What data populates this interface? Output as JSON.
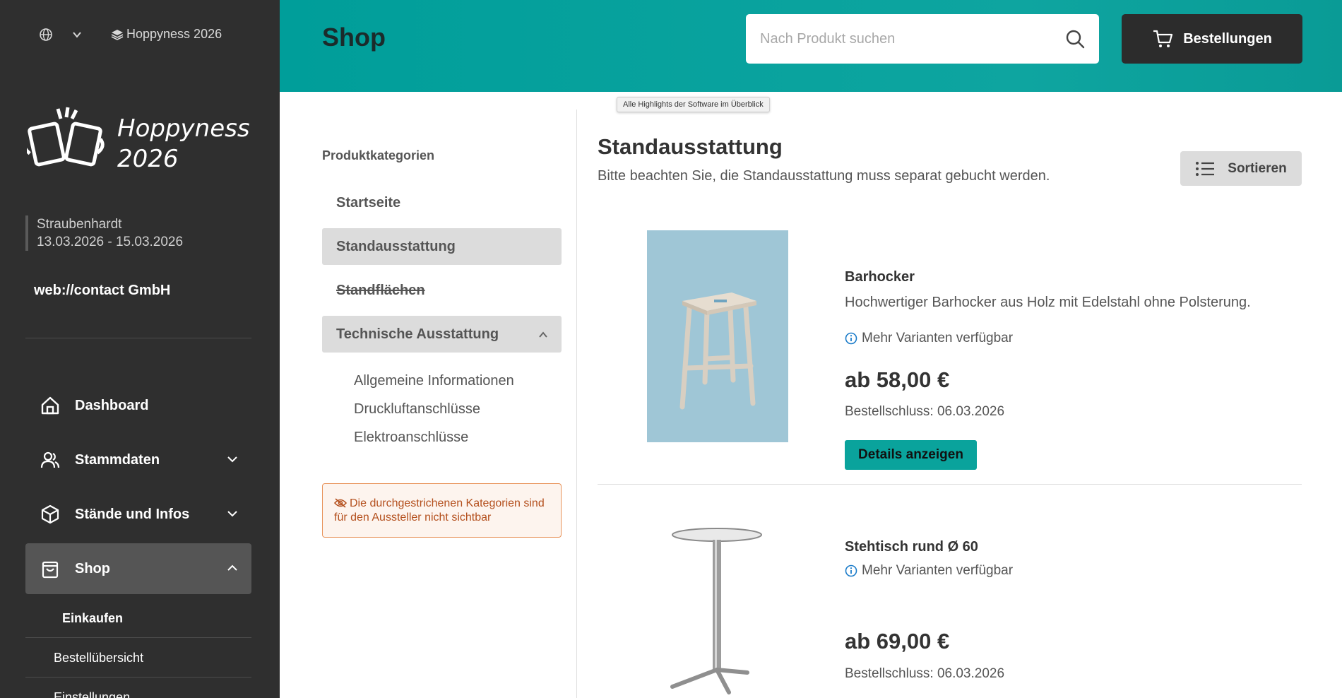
{
  "sidebar": {
    "event_name": "Hoppyness 2026",
    "logo_text_line1": "Hoppyness",
    "logo_text_line2": "2026",
    "location": "Straubenhardt",
    "dates": "13.03.2026 - 15.03.2026",
    "company": "web://contact GmbH",
    "nav": [
      {
        "label": "Dashboard",
        "icon": "home-icon"
      },
      {
        "label": "Stammdaten",
        "icon": "users-icon"
      },
      {
        "label": "Stände und Infos",
        "icon": "box-icon"
      },
      {
        "label": "Shop",
        "icon": "shopping-bag-icon"
      }
    ],
    "shop_sub": [
      "Einkaufen",
      "Bestellübersicht",
      "Einstellungen"
    ]
  },
  "header": {
    "title": "Shop",
    "search_placeholder": "Nach Produkt suchen",
    "orders_label": "Bestellungen"
  },
  "tooltip": "Alle Highlights der Software im Überblick",
  "categories": {
    "title": "Produktkategorien",
    "items": [
      "Startseite",
      "Standausstattung",
      "Standflächen",
      "Technische Ausstattung"
    ],
    "sub_items": [
      "Allgemeine Informationen",
      "Druckluftanschlüsse",
      "Elektroanschlüsse"
    ],
    "notice": "Die durchgestrichenen Kategorien sind für den Aussteller nicht sichtbar"
  },
  "main": {
    "title": "Standausstattung",
    "subtitle": "Bitte beachten Sie, die Standausstattung muss separat gebucht werden.",
    "sort_label": "Sortieren",
    "products": [
      {
        "name": "Barhocker",
        "description": "Hochwertiger Barhocker aus Holz mit Edelstahl ohne Polsterung.",
        "variants": "Mehr Varianten verfügbar",
        "price": "ab 58,00 €",
        "deadline": "Bestellschluss: 06.03.2026",
        "details_label": "Details anzeigen"
      },
      {
        "name": "Stehtisch rund Ø 60",
        "variants": "Mehr Varianten verfügbar",
        "price": "ab 69,00 €",
        "deadline": "Bestellschluss: 06.03.2026"
      }
    ]
  },
  "colors": {
    "sidebar_bg": "#2f2f2f",
    "header_teal": "#009e9a",
    "accent_button": "#0aa39c",
    "notice_border": "#e8935a",
    "notice_text": "#b4501e"
  }
}
